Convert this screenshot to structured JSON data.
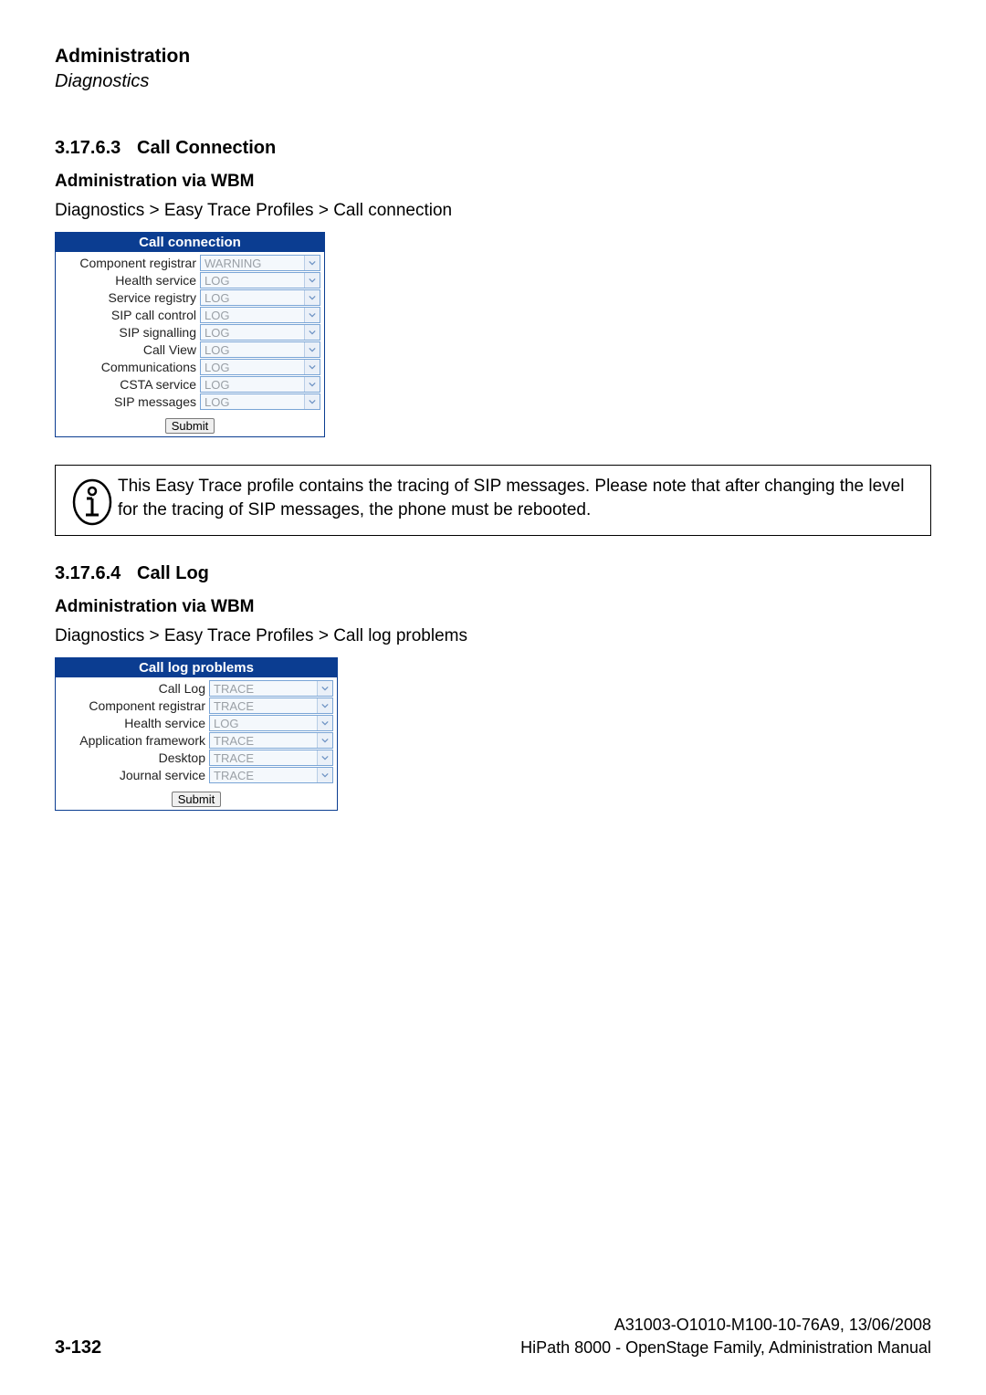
{
  "header": {
    "title": "Administration",
    "subtitle": "Diagnostics"
  },
  "section1": {
    "number": "3.17.6.3",
    "title": "Call Connection",
    "subhead": "Administration via WBM",
    "breadcrumb": "Diagnostics > Easy Trace Profiles > Call connection",
    "panel_title": "Call connection",
    "rows": [
      {
        "label": "Component registrar",
        "value": "WARNING"
      },
      {
        "label": "Health service",
        "value": "LOG"
      },
      {
        "label": "Service registry",
        "value": "LOG"
      },
      {
        "label": "SIP call control",
        "value": "LOG"
      },
      {
        "label": "SIP signalling",
        "value": "LOG"
      },
      {
        "label": "Call View",
        "value": "LOG"
      },
      {
        "label": "Communications",
        "value": "LOG"
      },
      {
        "label": "CSTA service",
        "value": "LOG"
      },
      {
        "label": "SIP messages",
        "value": "LOG"
      }
    ],
    "submit": "Submit"
  },
  "note": {
    "text": "This Easy Trace profile contains the tracing of SIP messages. Please note that after changing the level for the tracing of SIP messages, the phone must be rebooted."
  },
  "section2": {
    "number": "3.17.6.4",
    "title": "Call Log",
    "subhead": "Administration via WBM",
    "breadcrumb": "Diagnostics > Easy Trace Profiles > Call log problems",
    "panel_title": "Call log problems",
    "rows": [
      {
        "label": "Call Log",
        "value": "TRACE"
      },
      {
        "label": "Component registrar",
        "value": "TRACE"
      },
      {
        "label": "Health service",
        "value": "LOG"
      },
      {
        "label": "Application framework",
        "value": "TRACE"
      },
      {
        "label": "Desktop",
        "value": "TRACE"
      },
      {
        "label": "Journal service",
        "value": "TRACE"
      }
    ],
    "submit": "Submit"
  },
  "footer": {
    "page": "3-132",
    "doc_id": "A31003-O1010-M100-10-76A9, 13/06/2008",
    "doc_title": "HiPath 8000 - OpenStage Family, Administration Manual"
  }
}
